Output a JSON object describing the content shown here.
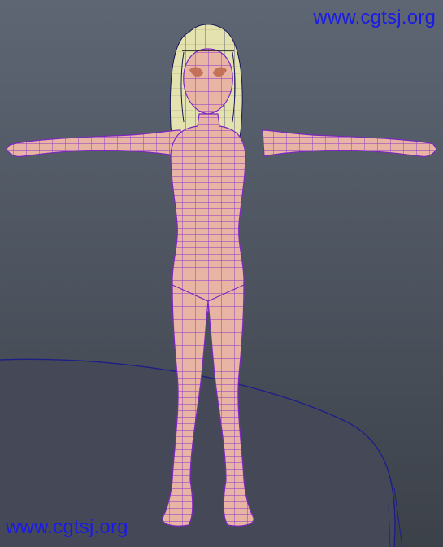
{
  "scene": {
    "subject": "female-character-wireframe-tpose",
    "colors": {
      "background_top": "#5e6674",
      "background_bottom": "#3c4149",
      "skin": "#e8b4a4",
      "wireframe": "#8a32c8",
      "hair": "#e4e3b0",
      "ground": "#454957",
      "ground_edge": "#1e1e88"
    }
  },
  "watermarks": {
    "top": "www.cgtsj.org",
    "top_color": "#1a1ae6",
    "bottom": "www.cgtsj.org",
    "bottom_color": "#1a1ae6"
  }
}
